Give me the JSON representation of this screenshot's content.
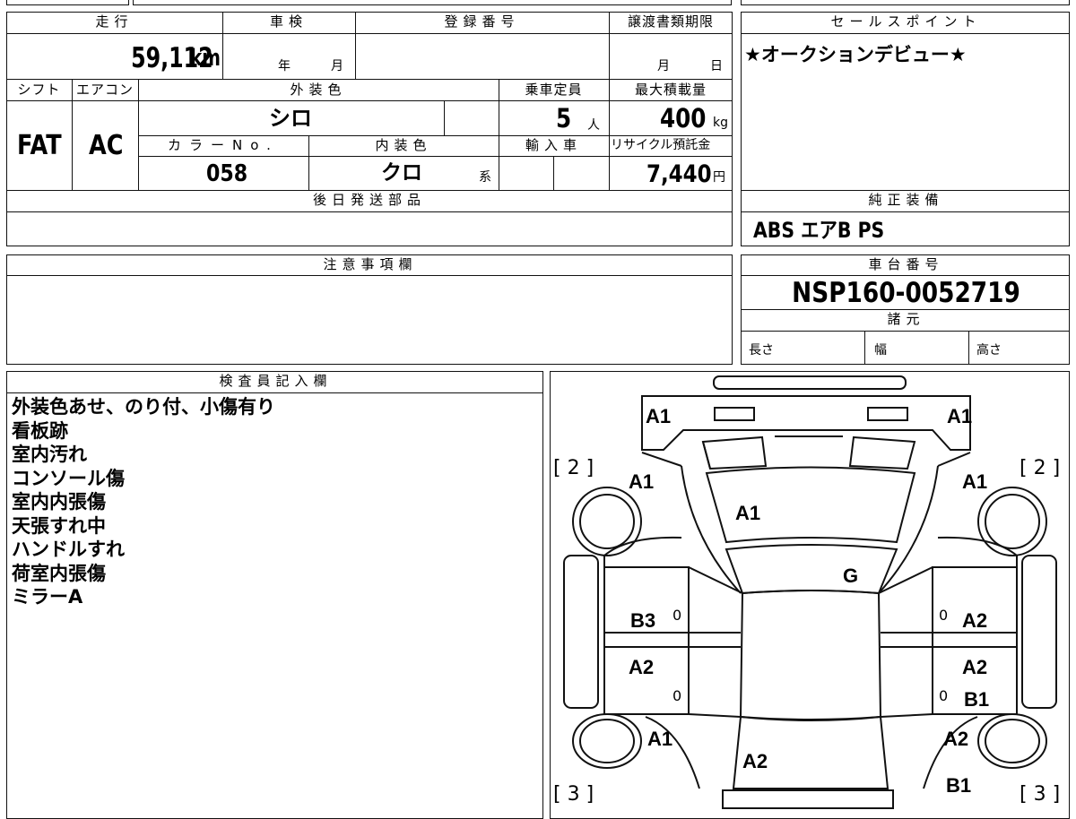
{
  "top_block": {
    "headers": {
      "mileage": "走行",
      "inspection": "車検",
      "registration": "登録番号",
      "transfer_deadline": "譲渡書類期限"
    },
    "mileage_value": "59,112",
    "mileage_unit": "km",
    "inspection_year_unit": "年",
    "inspection_month_unit": "月",
    "transfer_month_unit": "月",
    "transfer_day_unit": "日",
    "shift_label": "シフト",
    "ac_label": "エアコン",
    "exterior_color_label": "外装色",
    "capacity_label": "乗車定員",
    "max_load_label": "最大積載量",
    "shift_value": "FAT",
    "ac_value": "AC",
    "exterior_color_value": "シロ",
    "capacity_value": "5",
    "capacity_unit": "人",
    "max_load_value": "400",
    "max_load_unit": "kg",
    "color_no_label": "カラーNo.",
    "interior_color_label": "内装色",
    "import_label": "輸入車",
    "recycle_label": "リサイクル預託金",
    "color_no_value": "058",
    "interior_color_value": "クロ",
    "interior_color_suffix": "系",
    "recycle_value": "7,440",
    "recycle_unit": "円",
    "later_parts_label": "後日発送部品"
  },
  "sales_point": {
    "label": "セールスポイント",
    "text": "★オークションデビュー★"
  },
  "standard_equipment": {
    "label": "純正装備",
    "text": "ABS エアB PS"
  },
  "caution": {
    "label": "注意事項欄"
  },
  "chassis": {
    "label": "車台番号",
    "value": "NSP160-0052719",
    "specs_label": "諸元",
    "length_label": "長さ",
    "width_label": "幅",
    "height_label": "高さ"
  },
  "inspector": {
    "label": "検査員記入欄",
    "notes": [
      "外装色あせ、のり付、小傷有り",
      "看板跡",
      "室内汚れ",
      "コンソール傷",
      "室内内張傷",
      "天張すれ中",
      "ハンドルすれ",
      "荷室内張傷",
      "ミラーA"
    ]
  },
  "diagram": {
    "tire_count_front_left": "[ 2 ]",
    "tire_count_front_right": "[ 2 ]",
    "tire_count_rear_left": "[ 3 ]",
    "tire_count_rear_right": "[ 3 ]",
    "labels": {
      "front_bumper_left": "A1",
      "front_bumper_right": "A1",
      "front_fender_left": "A1",
      "front_fender_right": "A1",
      "hood": "A1",
      "windshield": "G",
      "front_door_left": "B3",
      "front_door_right": "A2",
      "rear_door_left": "A2",
      "rear_door_right_a": "A2",
      "rear_door_right_b": "B1",
      "rear_fender_left": "A1",
      "rear_fender_right": "A2",
      "tailgate": "A2",
      "rear_bumper_right": "B1",
      "door_zero_1": "0",
      "door_zero_2": "0",
      "door_zero_3": "0",
      "door_zero_4": "0"
    }
  }
}
